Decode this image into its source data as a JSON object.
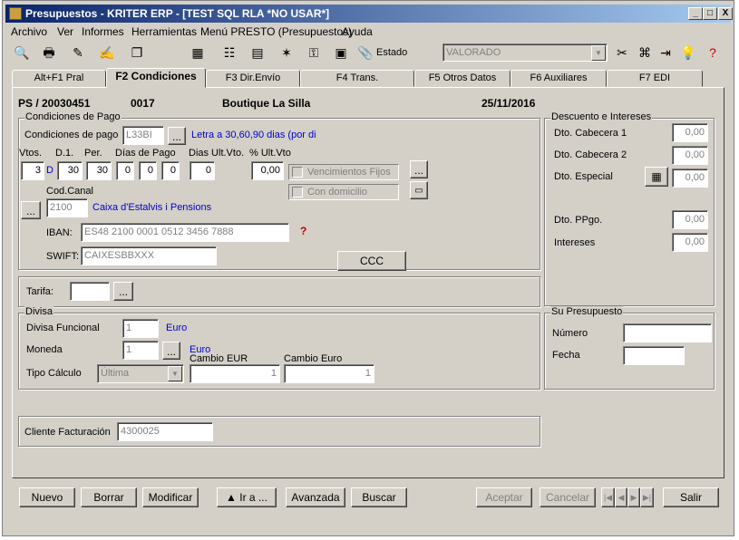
{
  "window": {
    "title": "Presupuestos - KRITER ERP - [TEST SQL RLA *NO USAR*]",
    "minimize": "_",
    "maximize": "□",
    "close": "X"
  },
  "menu": [
    "Archivo",
    "Ver",
    "Informes",
    "Herramientas",
    "Menú PRESTO (Presupuestos)",
    "Ayuda"
  ],
  "toolbar": {
    "estado_label": "Estado",
    "estado_value": "VALORADO",
    "icons": [
      "preview-icon",
      "print-icon",
      "edit-icon",
      "notes-icon",
      "copy-icon",
      "table-icon",
      "tree-icon",
      "calc-icon",
      "star-icon",
      "key-icon",
      "book-icon",
      "clip-icon"
    ]
  },
  "tabs": [
    "Alt+F1 Pral",
    "F2 Condiciones",
    "F3 Dir.Envío",
    "F4 Trans.",
    "F5 Otros Datos",
    "F6 Auxiliares",
    "F7 EDI"
  ],
  "header": {
    "doc": "PS / 20030451",
    "code": "0017",
    "client": "Boutique La Silla",
    "date": "25/11/2016"
  },
  "condiciones_pago": {
    "group_label": "Condiciones de Pago",
    "label": "Condiciones de pago",
    "code": "L33BI",
    "description": "Letra a 30,60,90 dias (por di",
    "vtos_label": "Vtos.",
    "d1_label": "D.1.",
    "per_label": "Per.",
    "dias_pago_label": "Días de Pago",
    "dias_ult_label": "Dias Ult.Vto.",
    "pct_ult_label": "% Ult.Vto",
    "vtos": "3",
    "d_suffix": "D",
    "d1": "30",
    "per": "30",
    "dias_pago": [
      "0",
      "0",
      "0"
    ],
    "dias_ult": "0",
    "pct_ult": "0,00",
    "vencimientos_fijos": "Vencimientos Fijos",
    "con_domicilio": "Con domicilio",
    "cod_canal_label": "Cod.Canal",
    "cod_canal": "2100",
    "bank_name": "Caixa d'Estalvis i Pensions",
    "iban_label": "IBAN:",
    "iban": "ES48 2100 0001 0512 3456 7888",
    "swift_label": "SWIFT:",
    "swift": "CAIXESBBXXX",
    "ccc_button": "CCC",
    "ellipsis": "..."
  },
  "tarifa": {
    "label": "Tarifa:",
    "value": ""
  },
  "divisa": {
    "group_label": "Divisa",
    "funcional_label": "Divisa Funcional",
    "funcional_value": "1",
    "funcional_name": "Euro",
    "moneda_label": "Moneda",
    "moneda_value": "1",
    "moneda_name": "Euro",
    "tipo_label": "Tipo Cálculo",
    "tipo_value": "Última",
    "cambio_eur_label": "Cambio EUR",
    "cambio_eur": "1",
    "cambio_euro_label": "Cambio Euro",
    "cambio_euro": "1"
  },
  "cliente_facturacion": {
    "label": "Cliente Facturación",
    "value": "4300025"
  },
  "descuentos": {
    "group_label": "Descuento e Intereses",
    "cab1_label": "Dto. Cabecera 1",
    "cab1": "0,00",
    "cab2_label": "Dto. Cabecera 2",
    "cab2": "0,00",
    "especial_label": "Dto. Especial",
    "especial": "0,00",
    "ppgo_label": "Dto. PPgo.",
    "ppgo": "0,00",
    "intereses_label": "Intereses",
    "intereses": "0,00"
  },
  "su_presupuesto": {
    "group_label": "Su Presupuesto",
    "numero_label": "Número",
    "numero": "",
    "fecha_label": "Fecha",
    "fecha": ""
  },
  "buttons": {
    "nuevo": "Nuevo",
    "borrar": "Borrar",
    "modificar": "Modificar",
    "ir_a": "▲ Ir a ...",
    "avanzada": "Avanzada",
    "buscar": "Buscar",
    "aceptar": "Aceptar",
    "cancelar": "Cancelar",
    "salir": "Salir"
  }
}
